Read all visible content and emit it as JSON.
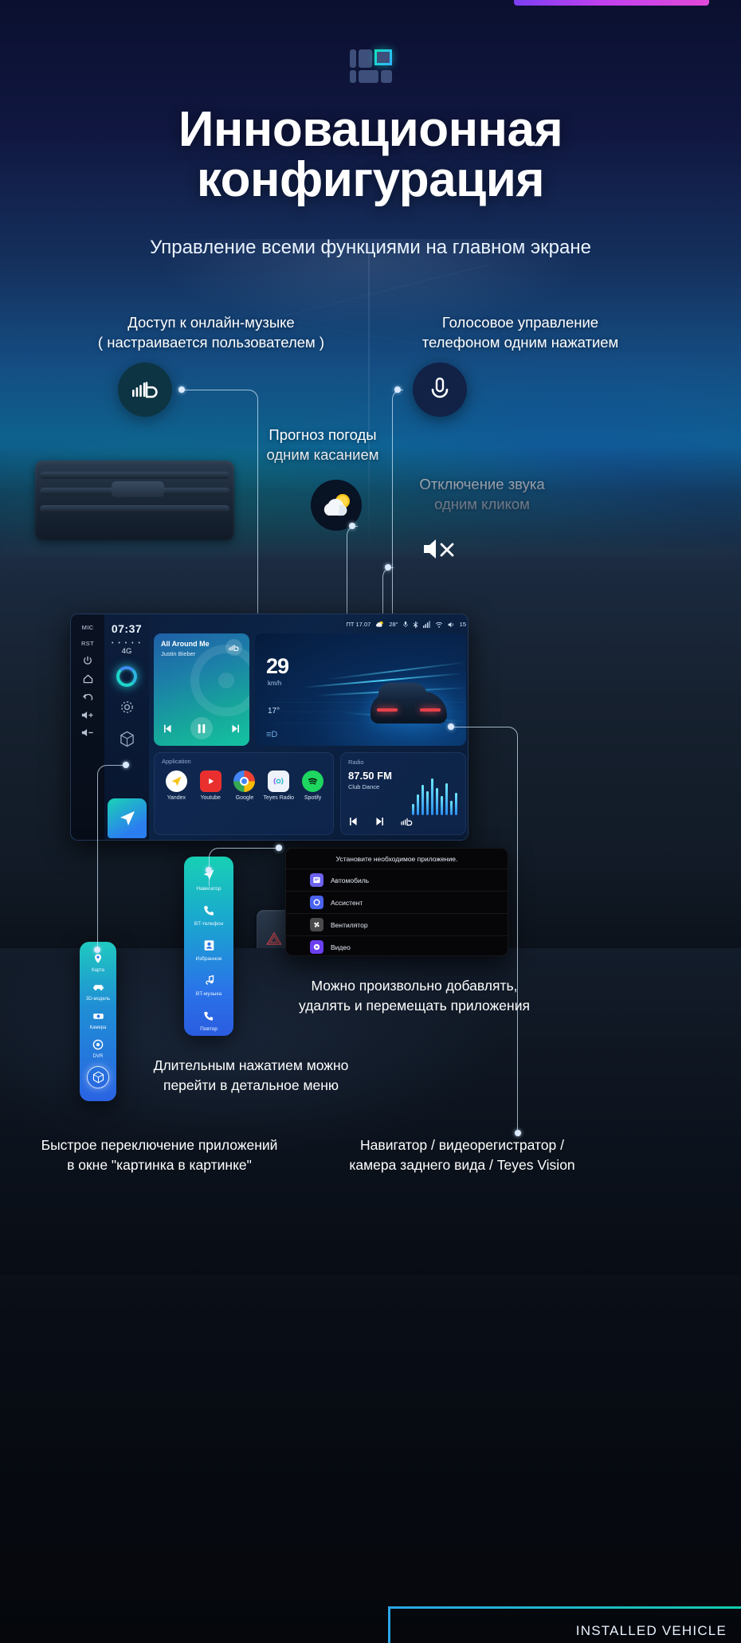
{
  "hero": {
    "logo_name": "teyes-logo",
    "title_line1": "Инновационная",
    "title_line2": "конфигурация",
    "subtitle": "Управление всеми функциями на главном экране"
  },
  "callouts": [
    {
      "id": "music",
      "line1": "Доступ к онлайн-музыке",
      "line2": "( настраивается пользователем )",
      "icon": "soundcloud-icon"
    },
    {
      "id": "voice",
      "line1": "Голосовое управление",
      "line2": "телефоном одним нажатием",
      "icon": "microphone-icon"
    },
    {
      "id": "weather",
      "line1": "Прогноз погоды",
      "line2": "одним касанием",
      "icon": "partly-cloudy-icon"
    },
    {
      "id": "mute",
      "line1": "Отключение звука",
      "line2": "одним кликом",
      "icon": "mute-icon"
    }
  ],
  "head_unit": {
    "hardware_keys": [
      "MIC",
      "RST"
    ],
    "hardware_icons": [
      "power-icon",
      "home-icon",
      "back-icon",
      "volume-up-icon",
      "volume-down-icon"
    ],
    "clock": "07:37",
    "signal_dots": "• • • • •",
    "network": "4G",
    "status_bar": {
      "day_date": "ПТ 17.07",
      "temperature": "28°",
      "icons": [
        "mic-icon",
        "bluetooth-icon",
        "signal-icon",
        "wifi-icon",
        "volume-icon"
      ],
      "volume_value": "15"
    },
    "music_widget": {
      "track_title": "All Around Me",
      "artist": "Justin Bieber",
      "source_icon": "soundcloud-icon",
      "controls": [
        "previous-icon",
        "pause-icon",
        "next-icon"
      ]
    },
    "nav_widget": {
      "speed": "29",
      "speed_unit": "km/h",
      "temperature": "17°",
      "headlight_label": "≡D"
    },
    "apps_widget": {
      "label": "Application",
      "apps": [
        {
          "name": "Yandex",
          "icon": "yandex-icon"
        },
        {
          "name": "Youtube",
          "icon": "youtube-icon"
        },
        {
          "name": "Google",
          "icon": "chrome-icon"
        },
        {
          "name": "Teyes Radio",
          "icon": "teyes-radio-icon"
        },
        {
          "name": "Spotify",
          "icon": "spotify-icon"
        }
      ]
    },
    "radio_widget": {
      "label": "Radio",
      "frequency": "87.50 FM",
      "program": "Club Dance",
      "controls": [
        "previous-icon",
        "next-icon",
        "soundcloud-icon"
      ],
      "equalizer_bars": [
        14,
        26,
        38,
        30,
        46,
        34,
        24,
        40,
        18,
        28
      ]
    },
    "pip_icon": "navigation-arrow-icon"
  },
  "strip_primary": {
    "items": [
      {
        "label": "Навигатор",
        "icon": "navigation-arrow-icon"
      },
      {
        "label": "BT-телефон",
        "icon": "phone-icon"
      },
      {
        "label": "Избранное",
        "icon": "contact-icon"
      },
      {
        "label": "BT-музыка",
        "icon": "music-note-icon"
      },
      {
        "label": "Повтор",
        "icon": "phone-repeat-icon"
      }
    ]
  },
  "strip_secondary": {
    "items": [
      {
        "label": "Карта",
        "icon": "map-pin-icon",
        "selected": false
      },
      {
        "label": "3D-модель",
        "icon": "car-3d-icon",
        "selected": false
      },
      {
        "label": "Камера",
        "icon": "camera-icon",
        "selected": false
      },
      {
        "label": "DVR",
        "icon": "dvr-icon",
        "selected": false
      },
      {
        "label": "",
        "icon": "cube-icon",
        "selected": true
      }
    ]
  },
  "install_dialog": {
    "title": "Установите необходимое приложение.",
    "rows": [
      {
        "label": "Автомобиль",
        "icon": "car-app-icon",
        "color": "#6b62f0"
      },
      {
        "label": "Ассистент",
        "icon": "assistant-icon",
        "color": "#4a63ef"
      },
      {
        "label": "Вентилятор",
        "icon": "fan-icon",
        "color": "#4a4a4a"
      },
      {
        "label": "Видео",
        "icon": "video-icon",
        "color": "#6b3ff0"
      }
    ]
  },
  "bottom_captions": {
    "apps_line1": "Можно произвольно добавлять,",
    "apps_line2": "удалять и перемещать приложения",
    "longpress_line1": "Длительным нажатием можно",
    "longpress_line2": "перейти в детальное меню",
    "pip_line1": "Быстрое переключение приложений",
    "pip_line2": "в окне \"картинка в картинке\"",
    "nav_line1": "Навигатор / видеорегистратор /",
    "nav_line2": "камера заднего вида / Teyes Vision"
  },
  "footer": {
    "text": "INSTALLED VEHICLE"
  },
  "colors": {
    "accent_cyan": "#14e0c0",
    "accent_blue": "#2fb7ff",
    "accent_purple": "#c040f0",
    "hero_dark": "#0b1030"
  }
}
